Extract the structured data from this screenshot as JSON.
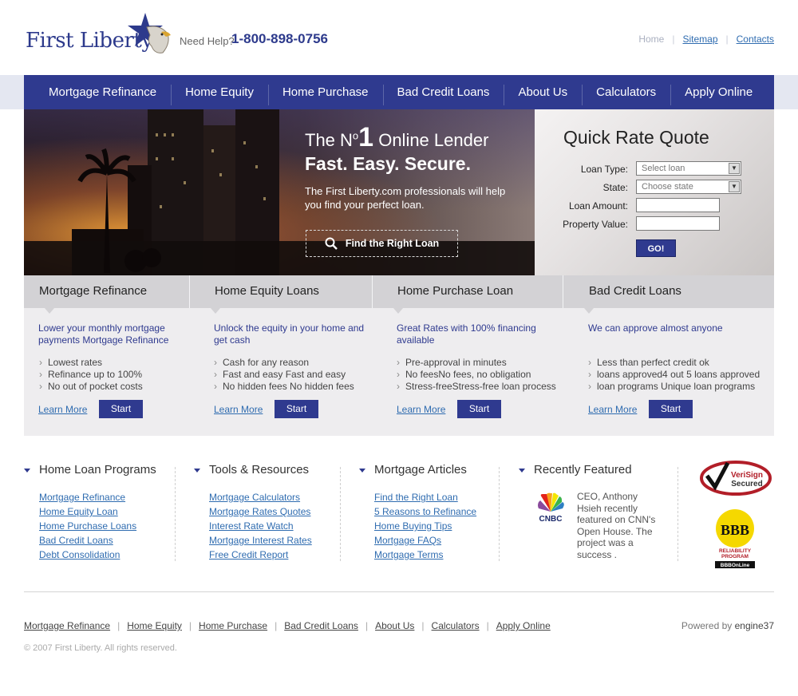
{
  "header": {
    "logo_text": "First Liberty",
    "need_help": "Need Help?",
    "phone": "1-800-898-0756",
    "toplinks": {
      "home": "Home",
      "sitemap": "Sitemap",
      "contact": "Contacts"
    }
  },
  "nav": {
    "items": [
      "Mortgage Refinance",
      "Home Equity",
      "Home Purchase",
      "Bad Credit Loans",
      "About Us",
      "Calculators",
      "Apply Online"
    ]
  },
  "hero": {
    "line1_pre": "The N",
    "line1_sup": "o",
    "line1_num": "1",
    "line1_post": "Online Lender",
    "line2": "Fast. Easy. Secure.",
    "desc": "The First Liberty.com professionals will help you find your perfect loan.",
    "button": "Find the Right Loan"
  },
  "quote": {
    "title": "Quick Rate Quote",
    "loan_type_label": "Loan Type:",
    "loan_type_value": "Select loan",
    "state_label": "State:",
    "state_value": "Choose state",
    "loan_amount_label": "Loan Amount:",
    "property_value_label": "Property Value:",
    "go": "GO!"
  },
  "products": [
    {
      "title": "Mortgage Refinance",
      "lead": "Lower your monthly mortgage payments Mortgage Refinance",
      "bullets": [
        "Lowest rates",
        "Refinance up to 100%",
        "No out of pocket costs"
      ],
      "learn": "Learn More",
      "start": "Start"
    },
    {
      "title": "Home Equity Loans",
      "lead": "Unlock the equity in your home and get cash",
      "bullets": [
        "Cash for any reason",
        "Fast and easy Fast and easy",
        "No hidden fees No hidden fees"
      ],
      "learn": "Learn More",
      "start": "Start"
    },
    {
      "title": "Home Purchase Loan",
      "lead": "Great Rates with 100% financing available",
      "bullets": [
        "Pre-approval in minutes",
        "No feesNo fees, no obligation",
        "Stress-freeStress-free loan process"
      ],
      "learn": "Learn More",
      "start": "Start"
    },
    {
      "title": "Bad Credit Loans",
      "lead": "We can approve almost anyone",
      "bullets": [
        "Less than perfect credit ok",
        "loans approved4 out 5 loans approved",
        "loan programs Unique loan programs"
      ],
      "learn": "Learn More",
      "start": "Start"
    }
  ],
  "footer_cols": [
    {
      "title": "Home Loan Programs",
      "links": [
        "Mortgage Refinance",
        "Home Equity Loan",
        "Home Purchase Loans",
        "Bad Credit Loans",
        "Debt Consolidation"
      ]
    },
    {
      "title": "Tools & Resources",
      "links": [
        "Mortgage Calculators",
        "Mortgage Rates Quotes",
        "Interest Rate Watch",
        "Mortgage Interest Rates",
        "Free Credit Report"
      ]
    },
    {
      "title": "Mortgage Articles",
      "links": [
        "Find the Right Loan",
        "5 Reasons to Refinance",
        "Home Buying Tips",
        "Mortgage FAQs",
        "Mortgage Terms"
      ]
    }
  ],
  "featured": {
    "title": "Recently Featured",
    "text": "CEO, Anthony Hsieh recently featured on CNN's Open House. The project was a success .",
    "cnbc": "CNBC",
    "verisign_line1": "VeriSign",
    "verisign_line2": "Secured",
    "bbb": "BBB",
    "bbb_sub1": "RELIABILITY",
    "bbb_sub2": "PROGRAM",
    "bbb_sub3": "BBBOnLine"
  },
  "bottom": {
    "links": [
      "Mortgage Refinance",
      "Home Equity",
      "Home Purchase",
      "Bad Credit Loans",
      "About Us",
      "Calculators",
      "Apply Online"
    ],
    "powered_prefix": "Powered by",
    "powered_brand": "engine37",
    "copyright": "© 2007 First Liberty. All rights reserved."
  },
  "colors": {
    "brand_navy": "#2f3a8f",
    "link_blue": "#2f6cb0",
    "panel_gray": "#eeedef"
  }
}
